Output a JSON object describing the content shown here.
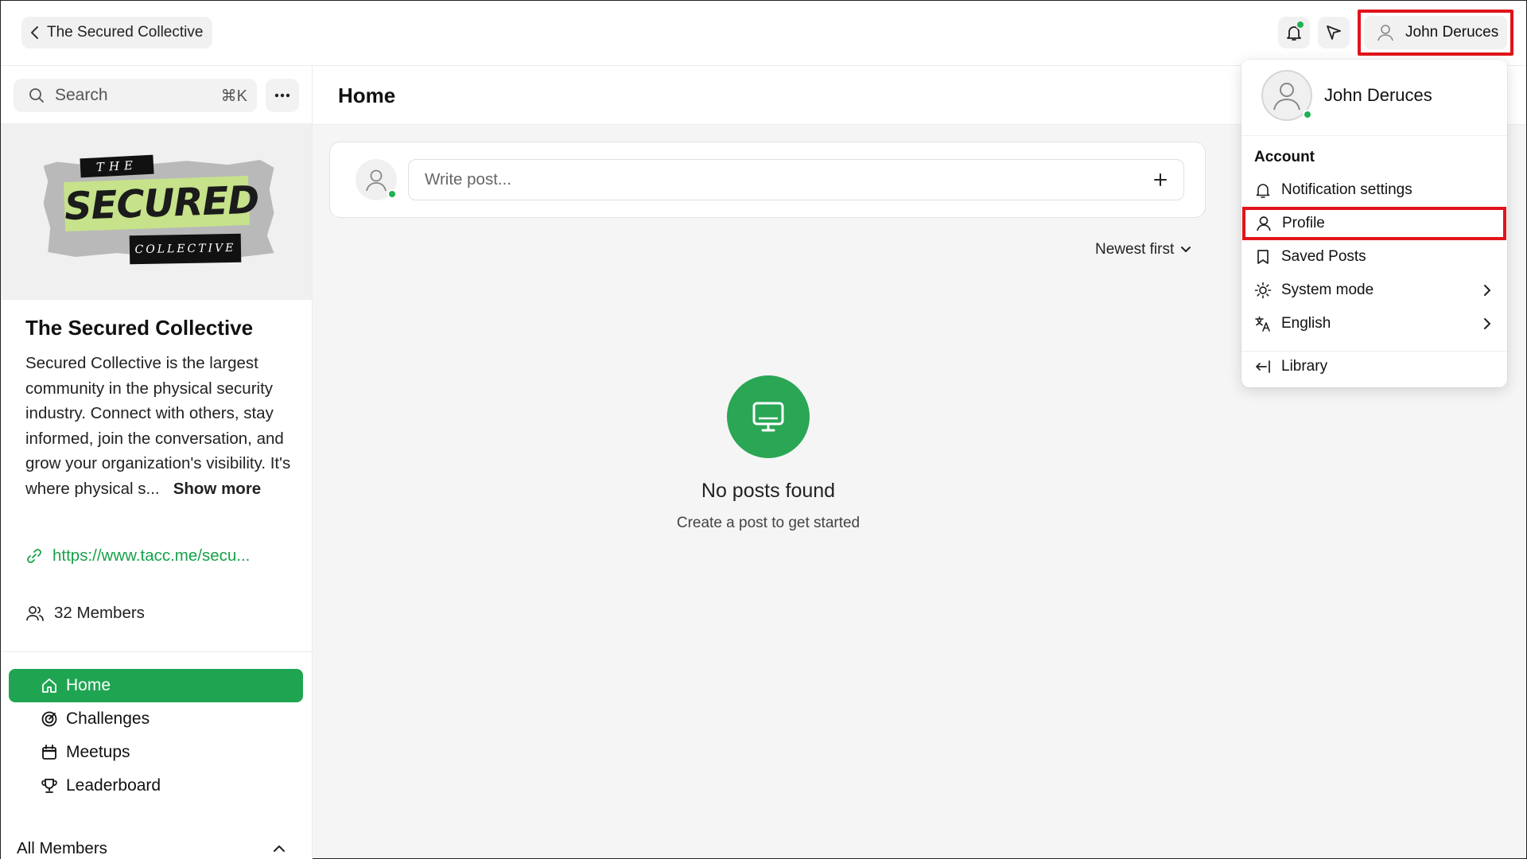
{
  "topbar": {
    "back_label": "The Secured Collective",
    "user_name": "John Deruces"
  },
  "sidebar": {
    "search_placeholder": "Search",
    "search_shortcut": "⌘K",
    "banner": {
      "the": "THE",
      "secured": "SECURED",
      "collective": "COLLECTIVE"
    },
    "community_title": "The Secured Collective",
    "community_description": "Secured Collective is the largest community in the physical security industry. Connect with others, stay informed, join the conversation, and grow your organization's visibility. It's where physical s...",
    "show_more": "Show more",
    "link": "https://www.tacc.me/secu...",
    "members": "32 Members",
    "nav": [
      {
        "label": "Home",
        "icon": "home-icon",
        "active": true
      },
      {
        "label": "Challenges",
        "icon": "target-icon",
        "active": false
      },
      {
        "label": "Meetups",
        "icon": "calendar-icon",
        "active": false
      },
      {
        "label": "Leaderboard",
        "icon": "trophy-icon",
        "active": false
      }
    ],
    "all_members": "All Members"
  },
  "main": {
    "title": "Home",
    "composer_placeholder": "Write post...",
    "sort_label": "Newest first",
    "empty_title": "No posts found",
    "empty_subtitle": "Create a post to get started"
  },
  "dropdown": {
    "name": "John Deruces",
    "section_label": "Account",
    "items": [
      {
        "label": "Notification settings",
        "icon": "bell-icon"
      },
      {
        "label": "Profile",
        "icon": "user-icon",
        "highlighted": true
      },
      {
        "label": "Saved Posts",
        "icon": "bookmark-icon"
      },
      {
        "label": "System mode",
        "icon": "sun-icon",
        "submenu": true
      },
      {
        "label": "English",
        "icon": "translate-icon",
        "submenu": true
      },
      {
        "label": "Library",
        "icon": "exit-icon"
      }
    ]
  },
  "colors": {
    "accent_green": "#1fa552",
    "highlight_red": "#e0141a",
    "presence_green": "#1fb154"
  }
}
